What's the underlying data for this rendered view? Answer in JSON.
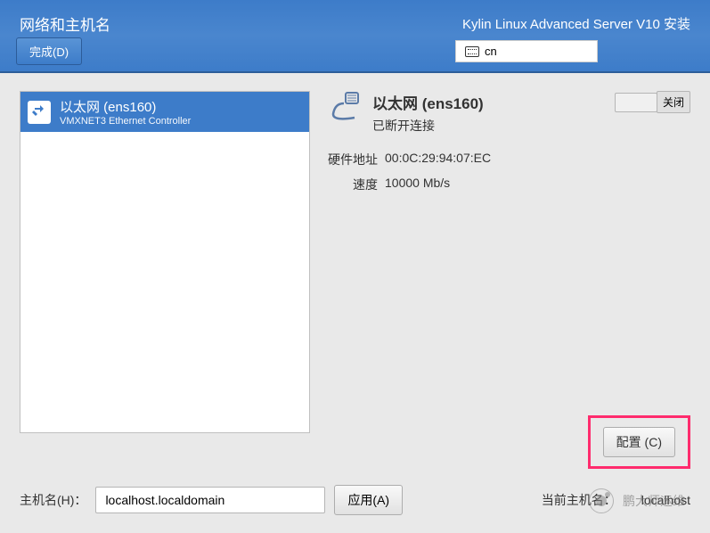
{
  "header": {
    "title": "网络和主机名",
    "subtitle": "Kylin Linux Advanced Server V10 安装",
    "done_label": "完成(D)",
    "lang": "cn"
  },
  "interface_list": [
    {
      "name": "以太网 (ens160)",
      "desc": "VMXNET3 Ethernet Controller"
    }
  ],
  "detail": {
    "title": "以太网 (ens160)",
    "status": "已断开连接",
    "toggle_off": "关闭",
    "props": {
      "hw_label": "硬件地址",
      "hw_value": "00:0C:29:94:07:EC",
      "speed_label": "速度",
      "speed_value": "10000 Mb/s"
    },
    "config_label": "配置 (C)"
  },
  "hostname": {
    "label": "主机名(H)：",
    "value": "localhost.localdomain",
    "apply_label": "应用(A)",
    "current_label": "当前主机名：",
    "current_value": "localhost"
  },
  "watermark": "鹏大师运维"
}
